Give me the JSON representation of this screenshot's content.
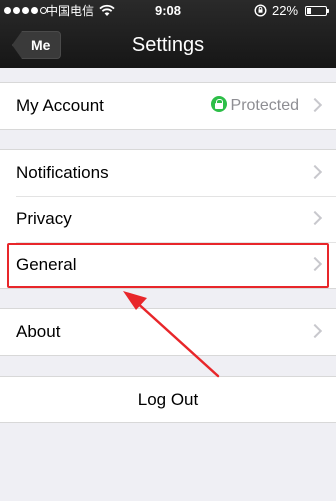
{
  "status_bar": {
    "carrier": "中国电信",
    "time": "9:08",
    "battery_percent": "22%",
    "battery_level": 0.22,
    "signal_bars_filled": 4,
    "signal_bars_total": 5
  },
  "nav": {
    "back_label": "Me",
    "title": "Settings"
  },
  "account": {
    "label": "My Account",
    "status": "Protected",
    "status_icon": "lock-icon",
    "status_color": "#2dbe48"
  },
  "settings_items": [
    {
      "label": "Notifications"
    },
    {
      "label": "Privacy"
    },
    {
      "label": "General"
    }
  ],
  "about": {
    "label": "About"
  },
  "logout": {
    "label": "Log Out"
  },
  "annotation": {
    "color": "#e8262a",
    "highlighted_item": "General"
  }
}
